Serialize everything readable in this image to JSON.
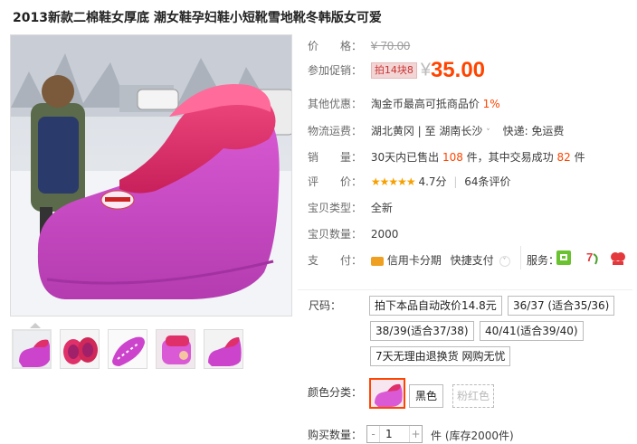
{
  "product": {
    "title": "2013新款二棉鞋女厚底 潮女鞋孕妇鞋小短靴雪地靴冬韩版女可爱"
  },
  "info": {
    "price_label": "价　　格：",
    "original_price": "¥ 70.00",
    "promo_label": "参加促销：",
    "promo_tag": "拍14块8",
    "yen": "¥",
    "promo_price": "35.00",
    "other_label": "其他优惠：",
    "other_text": "淘金币最高可抵商品价",
    "other_pct": "1%",
    "ship_label": "物流运费：",
    "ship_from": "湖北黄冈",
    "ship_sep": "|",
    "ship_to_prefix": "至",
    "ship_to": "湖南长沙",
    "ship_fee": "快递: 免运费",
    "sales_label": "销　　量：",
    "sales_text1": "30天内已售出",
    "sales_count": "108",
    "sales_text2": "件，其中交易成功",
    "sales_success": "82",
    "sales_text3": "件",
    "rating_label": "评　　价：",
    "rating_stars": "★★★★★",
    "rating_score": "4.7分",
    "rating_sep": "|",
    "rating_count": "64条评价",
    "cond_label": "宝贝类型：",
    "cond_value": "全新",
    "stock_label": "宝贝数量：",
    "stock_value": "2000",
    "pay_label": "支　　付：",
    "pay_credit": "信用卡分期",
    "pay_quick": "快捷支付",
    "service_label": "服务："
  },
  "options": {
    "size_label": "尺码：",
    "sizes": [
      "拍下本品自动改价14.8元",
      "36/37 (适合35/36)",
      "38/39(适合37/38)",
      "40/41(适合39/40)",
      "7天无理由退换货 网购无忧"
    ],
    "color_label": "颜色分类：",
    "colors": [
      "黑色",
      "粉红色"
    ],
    "qty_label": "购买数量：",
    "qty_minus": "-",
    "qty_value": "1",
    "qty_plus": "+",
    "qty_stock": "件 (库存2000件)"
  },
  "colors": {
    "accent": "#ff4400",
    "star": "#f6a000",
    "shoe_pink": "#cc44cc",
    "fur": "#e0306a"
  }
}
